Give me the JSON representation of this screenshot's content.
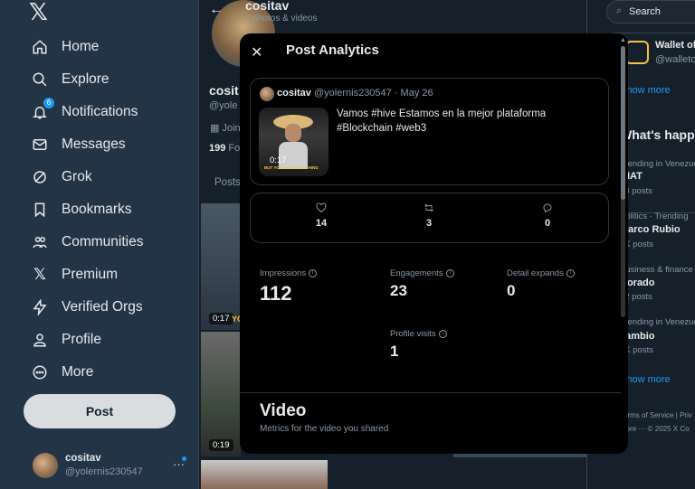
{
  "nav": {
    "items": [
      {
        "label": "Home",
        "icon": "home-icon"
      },
      {
        "label": "Explore",
        "icon": "search-icon"
      },
      {
        "label": "Notifications",
        "icon": "bell-icon",
        "badge": "6"
      },
      {
        "label": "Messages",
        "icon": "envelope-icon"
      },
      {
        "label": "Grok",
        "icon": "grok-icon"
      },
      {
        "label": "Bookmarks",
        "icon": "bookmark-icon"
      },
      {
        "label": "Communities",
        "icon": "people-icon"
      },
      {
        "label": "Premium",
        "icon": "x-logo-icon"
      },
      {
        "label": "Verified Orgs",
        "icon": "lightning-icon"
      },
      {
        "label": "Profile",
        "icon": "person-icon"
      },
      {
        "label": "More",
        "icon": "more-circle-icon"
      }
    ],
    "post_button": "Post",
    "account": {
      "name": "cositav",
      "handle": "@yolernis230547"
    }
  },
  "profile": {
    "title": "cositav",
    "subtitle": "7 photos & videos",
    "name": "cosit",
    "handle": "@yole",
    "joined": "Join",
    "following_count": "199",
    "following_label": "Fol",
    "tab": "Posts",
    "media": [
      {
        "duration": "0:17",
        "overlay": "YO"
      },
      {
        "duration": "0:19"
      }
    ]
  },
  "right": {
    "search_placeholder": "Search",
    "suggestion": {
      "name": "Wallet of S",
      "handle": "@walletofs"
    },
    "show_more": "Show more",
    "whats_happening": "What's happ",
    "trends": [
      {
        "meta": "Trending in Venezue",
        "name": "NIAT",
        "count": "43 posts"
      },
      {
        "meta": "Politics · Trending",
        "name": "Marco Rubio",
        "count": "6K posts"
      },
      {
        "meta": "Business & finance ·",
        "name": "Dorado",
        "count": "72 posts"
      },
      {
        "meta": "Trending in Venezue",
        "name": "cambio",
        "count": "6K posts"
      }
    ],
    "show_more_2": "Show more",
    "footer_1": "Terms of Service  |  Priv",
    "footer_2": "More ···  © 2025 X Co"
  },
  "modal": {
    "title": "Post Analytics",
    "post": {
      "name": "cositav",
      "handle_date": "@yolernis230547 · May 26",
      "text": "Vamos #hive Estamos en la mejor plataforma #Blockchain #web3",
      "thumb_duration": "0:17",
      "thumb_caption": "BUT YOU BUILD ANYTHING"
    },
    "engagement": {
      "likes": "14",
      "reposts": "3",
      "replies": "0"
    },
    "metrics": {
      "impressions_label": "Impressions",
      "impressions": "112",
      "engagements_label": "Engagements",
      "engagements": "23",
      "detail_expands_label": "Detail expands",
      "detail_expands": "0",
      "profile_visits_label": "Profile visits",
      "profile_visits": "1"
    },
    "video_title": "Video",
    "video_subtitle": "Metrics for the video you shared"
  },
  "colors": {
    "accent": "#1d9bf0",
    "background": "#15202b",
    "modal": "#000000"
  }
}
